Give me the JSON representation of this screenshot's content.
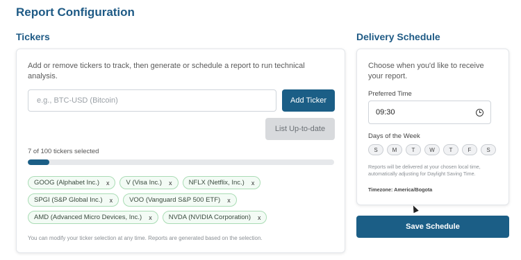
{
  "page": {
    "title": "Report Configuration"
  },
  "tickers": {
    "title": "Tickers",
    "intro": "Add or remove tickers to track, then generate or schedule a report to run technical analysis.",
    "input_placeholder": "e.g., BTC-USD (Bitcoin)",
    "add_label": "Add Ticker",
    "list_label": "List Up-to-date",
    "count_text": "7 of 100 tickers selected",
    "progress_fraction": 0.07,
    "chips": [
      [
        "GOOG (Alphabet Inc.)",
        "V (Visa Inc.)",
        "NFLX (Netflix, Inc.)"
      ],
      [
        "SPGI (S&P Global Inc.)",
        "VOO (Vanguard S&P 500 ETF)"
      ],
      [
        "AMD (Advanced Micro Devices, Inc.)",
        "NVDA (NVIDIA Corporation)"
      ]
    ],
    "remove_glyph": "x",
    "footnote": "You can modify your ticker selection at any time. Reports are generated based on the selection."
  },
  "delivery": {
    "title": "Delivery Schedule",
    "intro": "Choose when you'd like to receive your report.",
    "time_label": "Preferred Time",
    "time_value": "09:30",
    "days_label": "Days of the Week",
    "days": [
      "S",
      "M",
      "T",
      "W",
      "T",
      "F",
      "S"
    ],
    "note": "Reports will be delivered at your chosen local time, automatically adjusting for Daylight Saving Time.",
    "timezone": "Timezone: America/Bogota",
    "save_label": "Save Schedule"
  },
  "colors": {
    "accent": "#1b5e86",
    "heading": "#1e5a85",
    "chip_border": "#a9dcb4"
  }
}
